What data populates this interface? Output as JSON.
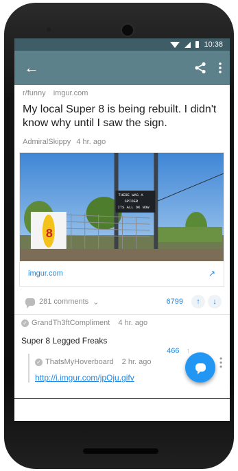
{
  "status": {
    "time": "10:38"
  },
  "post": {
    "subreddit": "r/funny",
    "domain": "imgur.com",
    "title": "My local Super 8 is being rebuilt. I didn't know why until I saw the sign.",
    "author": "AdmiralSkippy",
    "age": "4 hr. ago",
    "link_domain": "imgur.com",
    "image_sign_text": [
      "THERE WAS A",
      "SPIDER",
      "ITS ALL OK NOW"
    ],
    "comments": "281 comments",
    "score": "6799"
  },
  "comments": [
    {
      "author": "GrandTh3ftCompliment",
      "age": "4 hr. ago",
      "body": "Super 8 Legged Freaks",
      "score": "466"
    },
    {
      "author": "ThatsMyHoverboard",
      "age": "2 hr. ago",
      "body": "http://i.imgur.com/jpOju.gifv"
    }
  ]
}
